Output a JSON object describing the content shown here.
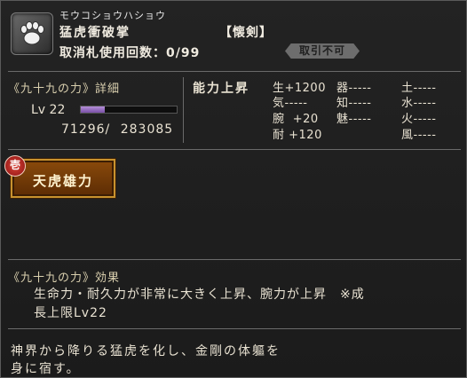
{
  "header": {
    "kana": "モウコショウハショウ",
    "name": "猛虎衝破掌",
    "subtype": "【懐剣】",
    "uses": "取消札使用回数：0/99",
    "trade_status": "取引不可"
  },
  "skill": {
    "title": "《九十九の力》詳細",
    "level": "Lv 22",
    "exp_progress": 0.25,
    "exp_current": "71296/",
    "exp_max": "283085",
    "button_label": "天虎雄力",
    "badge": "壱"
  },
  "ability": {
    "title": "能力上昇",
    "col1": [
      "生+1200",
      "気-----",
      "腕  +20",
      "耐 +120"
    ],
    "col2": [
      "器-----",
      "知-----",
      "魅-----"
    ],
    "col3": [
      "土-----",
      "水-----",
      "火-----",
      "風-----"
    ]
  },
  "effect": {
    "title": "《九十九の力》効果",
    "line1": "生命力・耐久力が非常に大きく上昇、腕力が上昇　※成",
    "line2": "長上限Lv22"
  },
  "flavor": {
    "line1": "神界から降りる猛虎を化し、金剛の体軀を",
    "line2": "身に宿す。"
  },
  "colors": {
    "background": "#1e1e1e",
    "button": "#7a3f08",
    "button_border": "#c8922e",
    "exp_bar": "#9a6fc4",
    "badge": "#b52a22"
  }
}
